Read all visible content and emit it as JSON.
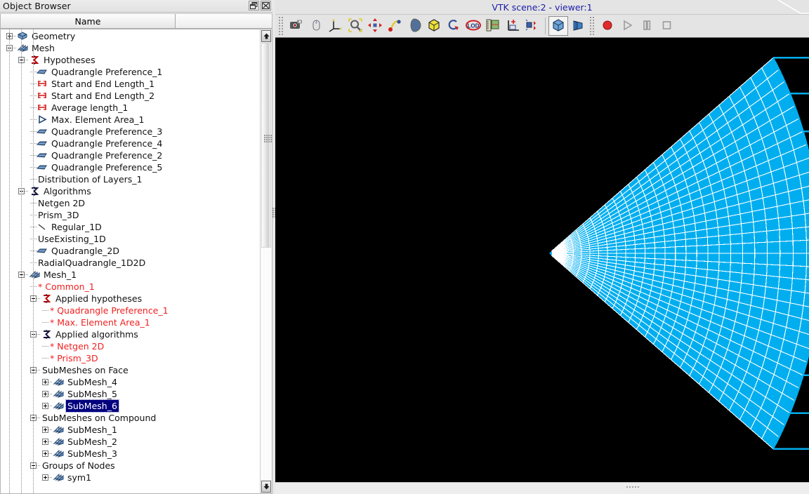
{
  "object_browser": {
    "title": "Object Browser",
    "column_header": "Name",
    "buttons": [
      {
        "name": "restore-button",
        "icon": "restore-icon"
      },
      {
        "name": "close-button",
        "icon": "close-icon"
      }
    ],
    "tree": [
      {
        "label": "Geometry",
        "depth": 0,
        "twisty": "plus",
        "icon": "geometry-icon",
        "red": false,
        "selected": false
      },
      {
        "label": "Mesh",
        "depth": 0,
        "twisty": "minus",
        "icon": "mesh-icon",
        "red": false,
        "selected": false
      },
      {
        "label": "Hypotheses",
        "depth": 1,
        "twisty": "minus",
        "icon": "sigma-red-icon",
        "red": false,
        "selected": false
      },
      {
        "label": "Quadrangle Preference_1",
        "depth": 2,
        "twisty": "leaf",
        "icon": "quad-icon",
        "red": false,
        "selected": false
      },
      {
        "label": "Start and End Length_1",
        "depth": 2,
        "twisty": "leaf",
        "icon": "length-icon",
        "red": false,
        "selected": false
      },
      {
        "label": "Start and End Length_2",
        "depth": 2,
        "twisty": "leaf",
        "icon": "length-icon",
        "red": false,
        "selected": false
      },
      {
        "label": "Average length_1",
        "depth": 2,
        "twisty": "leaf",
        "icon": "length-icon",
        "red": false,
        "selected": false
      },
      {
        "label": "Max. Element Area_1",
        "depth": 2,
        "twisty": "leaf",
        "icon": "area-icon",
        "red": false,
        "selected": false
      },
      {
        "label": "Quadrangle Preference_3",
        "depth": 2,
        "twisty": "leaf",
        "icon": "quad-icon",
        "red": false,
        "selected": false
      },
      {
        "label": "Quadrangle Preference_4",
        "depth": 2,
        "twisty": "leaf",
        "icon": "quad-icon",
        "red": false,
        "selected": false
      },
      {
        "label": "Quadrangle Preference_2",
        "depth": 2,
        "twisty": "leaf",
        "icon": "quad-icon",
        "red": false,
        "selected": false
      },
      {
        "label": "Quadrangle Preference_5",
        "depth": 2,
        "twisty": "leaf",
        "icon": "quad-icon",
        "red": false,
        "selected": false
      },
      {
        "label": "Distribution of Layers_1",
        "depth": 2,
        "twisty": "leaf",
        "icon": "none",
        "red": false,
        "selected": false
      },
      {
        "label": "Algorithms",
        "depth": 1,
        "twisty": "minus",
        "icon": "sigma-dark-icon",
        "red": false,
        "selected": false
      },
      {
        "label": "Netgen 2D",
        "depth": 2,
        "twisty": "leaf",
        "icon": "none",
        "red": false,
        "selected": false
      },
      {
        "label": "Prism_3D",
        "depth": 2,
        "twisty": "leaf",
        "icon": "none",
        "red": false,
        "selected": false
      },
      {
        "label": "Regular_1D",
        "depth": 2,
        "twisty": "leaf",
        "icon": "line-icon",
        "red": false,
        "selected": false
      },
      {
        "label": "UseExisting_1D",
        "depth": 2,
        "twisty": "leaf",
        "icon": "none",
        "red": false,
        "selected": false
      },
      {
        "label": "Quadrangle_2D",
        "depth": 2,
        "twisty": "leaf",
        "icon": "quad-icon",
        "red": false,
        "selected": false
      },
      {
        "label": "RadialQuadrangle_1D2D",
        "depth": 2,
        "twisty": "leaf",
        "icon": "none",
        "red": false,
        "selected": false
      },
      {
        "label": "Mesh_1",
        "depth": 1,
        "twisty": "minus",
        "icon": "mesh-icon",
        "red": false,
        "selected": false
      },
      {
        "label": "* Common_1",
        "depth": 2,
        "twisty": "leaf",
        "icon": "none",
        "red": true,
        "selected": false
      },
      {
        "label": "Applied hypotheses",
        "depth": 2,
        "twisty": "minus",
        "icon": "sigma-red-icon",
        "red": false,
        "selected": false
      },
      {
        "label": "* Quadrangle Preference_1",
        "depth": 3,
        "twisty": "leaf",
        "icon": "none",
        "red": true,
        "selected": false
      },
      {
        "label": "* Max. Element Area_1",
        "depth": 3,
        "twisty": "leaf",
        "icon": "none",
        "red": true,
        "selected": false
      },
      {
        "label": "Applied algorithms",
        "depth": 2,
        "twisty": "minus",
        "icon": "sigma-dark-icon",
        "red": false,
        "selected": false
      },
      {
        "label": "* Netgen 2D",
        "depth": 3,
        "twisty": "leaf",
        "icon": "none",
        "red": true,
        "selected": false
      },
      {
        "label": "* Prism_3D",
        "depth": 3,
        "twisty": "leaf",
        "icon": "none",
        "red": true,
        "selected": false
      },
      {
        "label": "SubMeshes on Face",
        "depth": 2,
        "twisty": "minus",
        "icon": "none",
        "red": false,
        "selected": false
      },
      {
        "label": "SubMesh_4",
        "depth": 3,
        "twisty": "plus",
        "icon": "mesh-icon",
        "red": false,
        "selected": false
      },
      {
        "label": "SubMesh_5",
        "depth": 3,
        "twisty": "plus",
        "icon": "mesh-icon",
        "red": false,
        "selected": false
      },
      {
        "label": "SubMesh_6",
        "depth": 3,
        "twisty": "plus",
        "icon": "mesh-icon",
        "red": false,
        "selected": true
      },
      {
        "label": "SubMeshes on Compound",
        "depth": 2,
        "twisty": "minus",
        "icon": "none",
        "red": false,
        "selected": false
      },
      {
        "label": "SubMesh_1",
        "depth": 3,
        "twisty": "plus",
        "icon": "mesh-icon",
        "red": false,
        "selected": false
      },
      {
        "label": "SubMesh_2",
        "depth": 3,
        "twisty": "plus",
        "icon": "mesh-icon",
        "red": false,
        "selected": false
      },
      {
        "label": "SubMesh_3",
        "depth": 3,
        "twisty": "plus",
        "icon": "mesh-icon",
        "red": false,
        "selected": false
      },
      {
        "label": "Groups of Nodes",
        "depth": 2,
        "twisty": "minus",
        "icon": "none",
        "red": false,
        "selected": false
      },
      {
        "label": "sym1",
        "depth": 3,
        "twisty": "plus",
        "icon": "mesh-icon",
        "red": false,
        "selected": false
      }
    ],
    "scrollbar": {
      "up_arrow": "scroll-up-icon",
      "down_arrow": "scroll-down-icon"
    }
  },
  "viewer": {
    "title": "VTK scene:2 - viewer:1",
    "toolbar": [
      {
        "name": "dump-view-button",
        "icon": "camera-icon"
      },
      {
        "name": "change-interaction-button",
        "icon": "mouse-icon"
      },
      {
        "name": "show-trihedron-button",
        "icon": "trihedron-icon"
      },
      {
        "name": "fit-all-button",
        "icon": "magnifier-icon"
      },
      {
        "name": "pan-button",
        "icon": "pan-icon"
      },
      {
        "name": "global-panning-button",
        "icon": "global-pan-icon"
      },
      {
        "name": "rotate-button",
        "icon": "rotate-icon"
      },
      {
        "name": "front-view-button",
        "icon": "cube-view-icon"
      },
      {
        "name": "reset-view-button",
        "icon": "reset-icon"
      },
      {
        "name": "lod-button",
        "icon": "lod-icon"
      },
      {
        "name": "scaling-button",
        "icon": "scaling-icon"
      },
      {
        "name": "graduated-axes-button",
        "icon": "graduated-axes-icon"
      },
      {
        "name": "update-rate-button",
        "icon": "update-rate-icon"
      },
      {
        "name": "orthographic-button",
        "icon": "ortho-cube-icon",
        "active": true
      },
      {
        "name": "perspective-button",
        "icon": "perspective-cube-icon",
        "active": false
      },
      {
        "name": "record-button",
        "icon": "record-icon"
      },
      {
        "name": "play-button",
        "icon": "play-icon"
      },
      {
        "name": "pause-button",
        "icon": "pause-icon"
      },
      {
        "name": "stop-button",
        "icon": "stop-icon"
      }
    ],
    "scene": {
      "background_color": "#000000",
      "mesh_fill_color": "#00aeef",
      "mesh_edge_color": "#ffffff",
      "outline_color": "#00aeef",
      "description": "radial quadrangle fan mesh with extruded layer lines"
    }
  }
}
